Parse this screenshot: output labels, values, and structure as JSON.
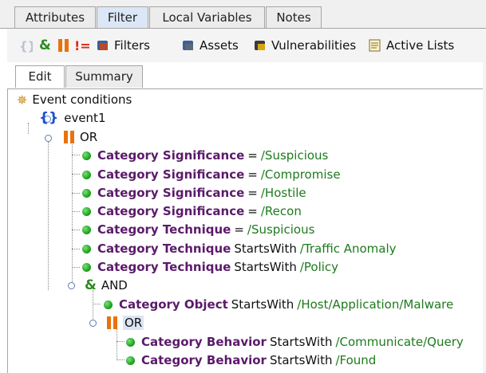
{
  "top_tabs": [
    {
      "label": "Attributes",
      "active": false
    },
    {
      "label": "Filter",
      "active": true
    },
    {
      "label": "Local Variables",
      "active": false
    },
    {
      "label": "Notes",
      "active": false
    }
  ],
  "toolbar": {
    "icons": [
      "braces-icon",
      "and-icon",
      "or-icon",
      "not-equal-icon"
    ],
    "not_equal_text": "!=",
    "and_text": "&",
    "filters_label": "Filters",
    "assets_label": "Assets",
    "vulnerabilities_label": "Vulnerabilities",
    "active_lists_label": "Active Lists"
  },
  "sub_tabs": [
    {
      "label": "Edit",
      "active": true
    },
    {
      "label": "Summary",
      "active": false
    }
  ],
  "tree": {
    "root_label": "Event conditions",
    "event_label": "event1",
    "event_glyph": "{}",
    "or_label": "OR",
    "and_label": "AND",
    "and_glyph": "&",
    "inner_or_label": "OR",
    "conditions": [
      {
        "field": "Category Significance",
        "op": "=",
        "value": "/Suspicious"
      },
      {
        "field": "Category Significance",
        "op": "=",
        "value": "/Compromise"
      },
      {
        "field": "Category Significance",
        "op": "=",
        "value": "/Hostile"
      },
      {
        "field": "Category Significance",
        "op": "=",
        "value": "/Recon"
      },
      {
        "field": "Category Technique",
        "op": "=",
        "value": "/Suspicious"
      },
      {
        "field": "Category Technique",
        "op": "StartsWith",
        "value": "/Traffic Anomaly"
      },
      {
        "field": "Category Technique",
        "op": "StartsWith",
        "value": "/Policy"
      }
    ],
    "and_conditions": [
      {
        "field": "Category Object",
        "op": "StartsWith",
        "value": "/Host/Application/Malware"
      }
    ],
    "inner_or_conditions": [
      {
        "field": "Category Behavior",
        "op": "StartsWith",
        "value": "/Communicate/Query"
      },
      {
        "field": "Category Behavior",
        "op": "StartsWith",
        "value": "/Found"
      }
    ]
  },
  "colors": {
    "field": "#5b1a6a",
    "value": "#1e7a1e",
    "or_bars": "#e8730c",
    "braces": "#1a4fd6",
    "and_amp": "#2e8b22",
    "condition_dot": "#139a13"
  }
}
